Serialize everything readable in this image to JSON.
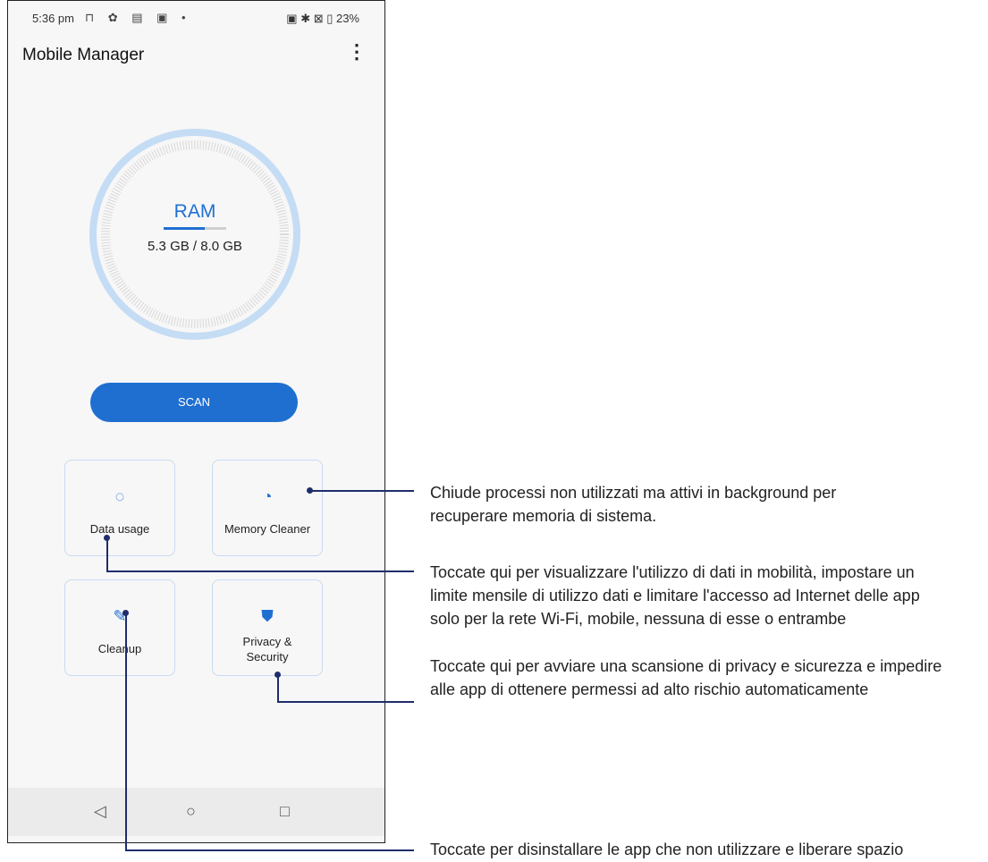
{
  "status_bar": {
    "time": "5:36 pm",
    "left_icons": "⊓ ✿ ▤ ▣ •",
    "right_icons": "▣ ✱ ⊠ ▯ 23%"
  },
  "app": {
    "title": "Mobile Manager",
    "menu": "⋮"
  },
  "ram": {
    "label": "RAM",
    "value": "5.3 GB / 8.0 GB",
    "usage_fraction": 0.6625
  },
  "scan_button": "SCAN",
  "tiles": [
    {
      "label": "Data usage",
      "icon": "data-usage-icon",
      "glyph": "◌"
    },
    {
      "label": "Memory Cleaner",
      "icon": "speedometer-icon",
      "glyph": "◔"
    },
    {
      "label": "Cleanup",
      "icon": "broom-icon",
      "glyph": "✎"
    },
    {
      "label": "Privacy & Security",
      "label_line1": "Privacy &",
      "label_line2": "Security",
      "icon": "shield-icon",
      "glyph": "⛊"
    }
  ],
  "nav": {
    "back": "◁",
    "home": "○",
    "recents": "□"
  },
  "callouts": {
    "memory_line1": "Chiude processi non utilizzati ma attivi in background per",
    "memory_line2": "recuperare memoria di sistema.",
    "data_line1": "Toccate qui per visualizzare l'utilizzo di dati in mobilità, impostare un",
    "data_line2": "limite mensile di utilizzo dati e limitare l'accesso ad Internet delle app",
    "data_line3": "solo per la rete Wi-Fi, mobile, nessuna di esse o entrambe",
    "privacy_line1": "Toccate qui per avviare una scansione di privacy e sicurezza e impedire",
    "privacy_line2": "alle app di ottenere permessi ad alto rischio automaticamente",
    "cleanup_line1": "Toccate per disinstallare le app che non utilizzare e liberare spazio"
  },
  "colors": {
    "accent": "#1f6fd1",
    "gauge_ring": "#c5dcf5",
    "leader_line": "#1f2d6b"
  }
}
